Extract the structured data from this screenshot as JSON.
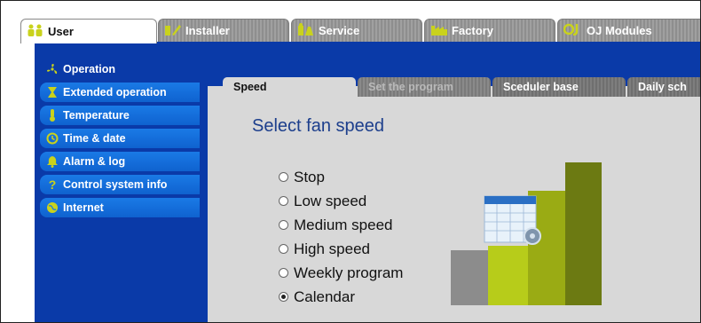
{
  "top_tabs": [
    {
      "label": "User",
      "icon": "users-icon",
      "active": true
    },
    {
      "label": "Installer",
      "icon": "installer-icon",
      "active": false
    },
    {
      "label": "Service",
      "icon": "service-icon",
      "active": false
    },
    {
      "label": "Factory",
      "icon": "factory-icon",
      "active": false
    },
    {
      "label": "OJ Modules",
      "icon": "oj-modules-icon",
      "active": false
    }
  ],
  "sidebar": {
    "items": [
      {
        "label": "Operation",
        "icon": "fan-icon",
        "active": true
      },
      {
        "label": "Extended operation",
        "icon": "hourglass-icon",
        "active": false
      },
      {
        "label": "Temperature",
        "icon": "thermometer-icon",
        "active": false
      },
      {
        "label": "Time & date",
        "icon": "clock-icon",
        "active": false
      },
      {
        "label": "Alarm & log",
        "icon": "bell-icon",
        "active": false
      },
      {
        "label": "Control system info",
        "icon": "question-icon",
        "active": false
      },
      {
        "label": "Internet",
        "icon": "globe-icon",
        "active": false
      }
    ]
  },
  "inner_tabs": [
    {
      "label": "Speed",
      "state": "active"
    },
    {
      "label": "Set the program",
      "state": "disabled"
    },
    {
      "label": "Sceduler base",
      "state": "inactive"
    },
    {
      "label": "Daily sch",
      "state": "inactive"
    }
  ],
  "panel": {
    "title": "Select fan speed",
    "options": [
      {
        "label": "Stop",
        "selected": false
      },
      {
        "label": "Low speed",
        "selected": false
      },
      {
        "label": "Medium speed",
        "selected": false
      },
      {
        "label": "High speed",
        "selected": false
      },
      {
        "label": "Weekly program",
        "selected": false
      },
      {
        "label": "Calendar",
        "selected": true
      }
    ]
  },
  "colors": {
    "band_blue": "#0a3aa8",
    "sidebar_blue": "#1a7ae6",
    "title_blue": "#1c3e8c",
    "bar_gray": "#8c8c8c",
    "bar_lime": "#b7cc1a",
    "bar_olive": "#9aab14",
    "bar_dark_olive": "#6c7a12"
  }
}
